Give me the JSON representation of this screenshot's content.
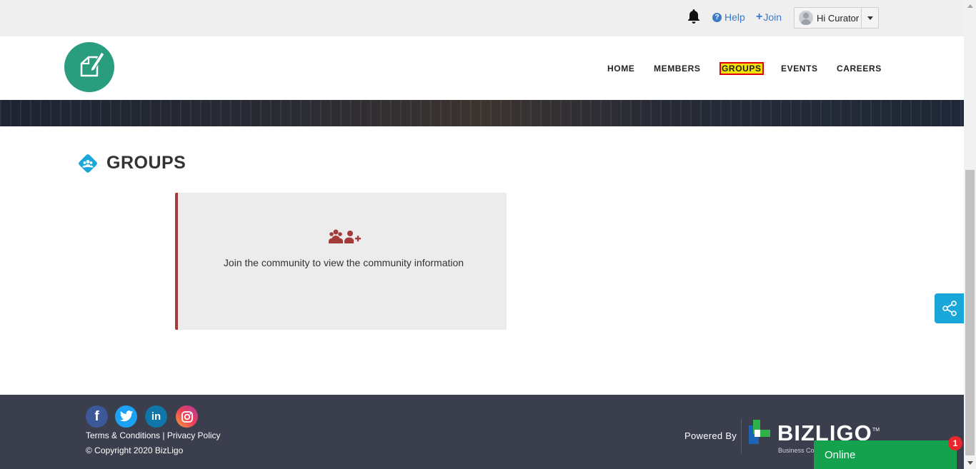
{
  "topbar": {
    "help_label": "Help",
    "join_label": "Join",
    "user_greeting": "Hi Curator",
    "icons": [
      "bell-icon",
      "question-circle-icon",
      "plus-icon",
      "avatar",
      "caret-down-icon"
    ]
  },
  "nav": {
    "items": [
      {
        "label": "HOME",
        "active": false
      },
      {
        "label": "MEMBERS",
        "active": false
      },
      {
        "label": "GROUPS",
        "active": true
      },
      {
        "label": "EVENTS",
        "active": false
      },
      {
        "label": "CAREERS",
        "active": false
      }
    ]
  },
  "page": {
    "title": "GROUPS",
    "notice": "Join the community to view the community information"
  },
  "footer": {
    "social": [
      "facebook",
      "twitter",
      "linkedin",
      "instagram"
    ],
    "terms_label": "Terms & Conditions",
    "separator": "|",
    "privacy_label": "Privacy Policy",
    "copyright": "© Copyright 2020 BizLigo",
    "powered_by": "Powered By",
    "brand_name": "BIZLIGO",
    "brand_tm": "TM",
    "brand_tagline": "Business Co"
  },
  "chat": {
    "label": "Online",
    "badge_count": "1"
  },
  "colors": {
    "brand_teal": "#2a9d7e",
    "link_blue": "#3a7bc8",
    "active_highlight": "#f7e300",
    "active_border": "#dd0000",
    "card_accent": "#a33b3b",
    "share_blue": "#19a6d8",
    "footer_bg": "#3b3f4d",
    "chat_green": "#14a24e",
    "badge_red": "#e8262c"
  }
}
